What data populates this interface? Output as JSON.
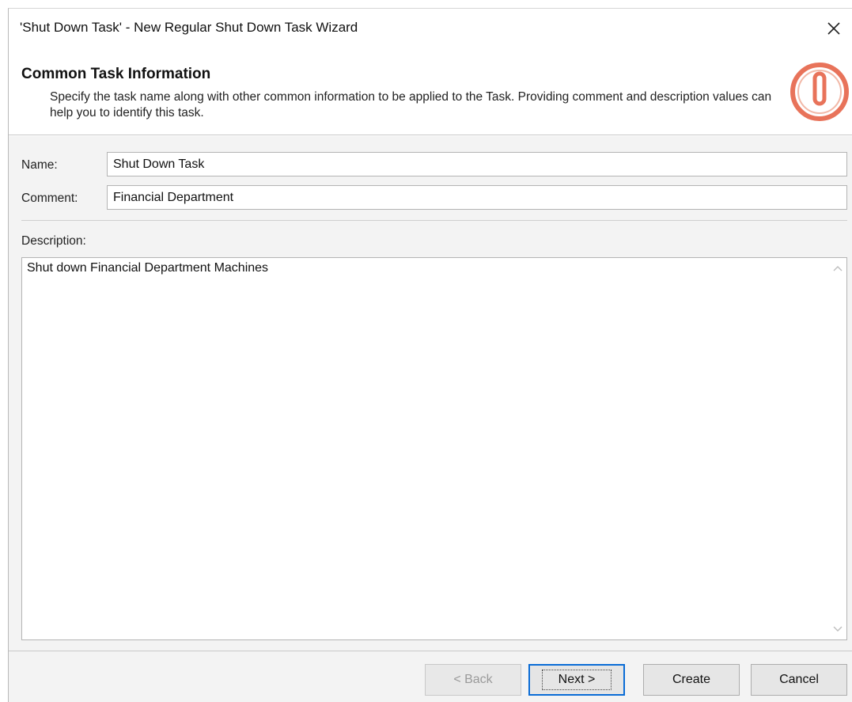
{
  "window": {
    "title": "'Shut Down Task' - New Regular Shut Down Task Wizard"
  },
  "header": {
    "title": "Common Task Information",
    "description": "Specify the task name along with other common information to be applied to the Task. Providing comment and description values can help you to identify this task.",
    "icon": "power-icon",
    "accent_color": "#e8735a"
  },
  "form": {
    "name_label": "Name:",
    "name_value": "Shut Down Task",
    "comment_label": "Comment:",
    "comment_value": "Financial Department",
    "description_label": "Description:",
    "description_value": "Shut down Financial Department Machines"
  },
  "footer": {
    "back_label": "< Back",
    "next_label": "Next >",
    "create_label": "Create",
    "cancel_label": "Cancel"
  }
}
